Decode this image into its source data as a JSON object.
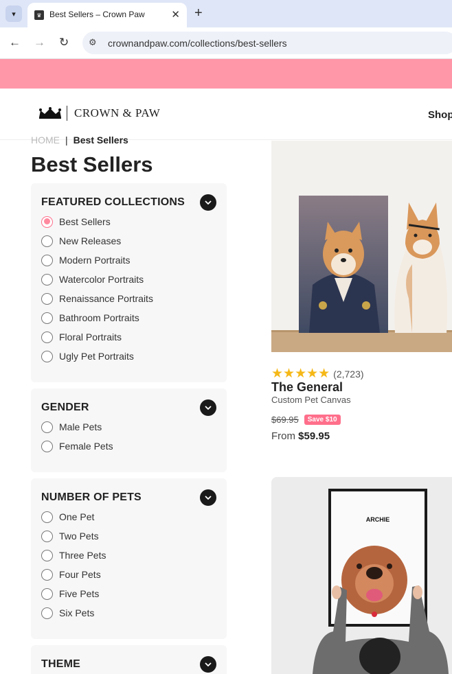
{
  "browser": {
    "tab_title": "Best Sellers – Crown Paw",
    "url": "crownandpaw.com/collections/best-sellers",
    "new_tab_symbol": "+",
    "close_symbol": "✕"
  },
  "header": {
    "logo_text": "CROWN & PAW",
    "nav_shop": "Shop"
  },
  "breadcrumb": {
    "home": "HOME",
    "separator": "|",
    "current": "Best Sellers"
  },
  "page_title": "Best Sellers",
  "filters": {
    "featured": {
      "heading": "FEATURED COLLECTIONS",
      "options": [
        "Best Sellers",
        "New Releases",
        "Modern Portraits",
        "Watercolor Portraits",
        "Renaissance Portraits",
        "Bathroom Portraits",
        "Floral Portraits",
        "Ugly Pet Portraits"
      ],
      "selected": "Best Sellers"
    },
    "gender": {
      "heading": "GENDER",
      "options": [
        "Male Pets",
        "Female Pets"
      ]
    },
    "number_of_pets": {
      "heading": "NUMBER OF PETS",
      "options": [
        "One Pet",
        "Two Pets",
        "Three Pets",
        "Four Pets",
        "Five Pets",
        "Six Pets"
      ]
    },
    "theme": {
      "heading": "THEME"
    }
  },
  "products": [
    {
      "rating_stars": "★★★★★",
      "rating_value": 5,
      "rating_count": "(2,723)",
      "name": "The General",
      "subtitle": "Custom Pet Canvas",
      "old_price": "$69.95",
      "save_badge": "Save  $10",
      "from_label": "From",
      "price": "$59.95"
    },
    {
      "poster_name": "ARCHIE"
    }
  ],
  "colors": {
    "promo_bar": "#ff97a9",
    "accent": "#ff6f8b",
    "star": "#f5b817"
  }
}
